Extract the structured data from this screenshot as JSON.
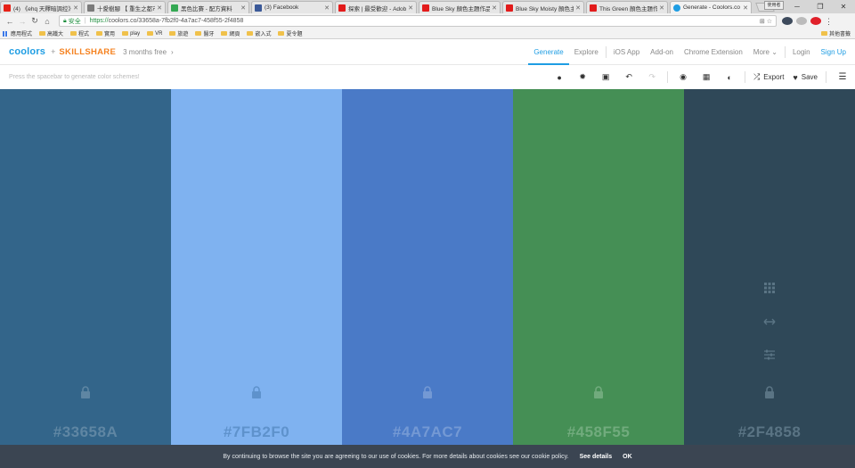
{
  "browser": {
    "tabs": [
      {
        "title": "(4) 《ehq 天釋暗調控》",
        "icon_color": "#e62117",
        "active": false
      },
      {
        "title": "十愛樹腳 【 重生之都市",
        "icon_color": "#7a7a7a",
        "active": false
      },
      {
        "title": "黑色比賽 - 配方資料",
        "icon_color": "#34a853",
        "active": false
      },
      {
        "title": "(3) Facebook",
        "icon_color": "#3b5998",
        "active": false
      },
      {
        "title": "探索 | 最受歡迎 - Adob",
        "icon_color": "#e21b1b",
        "active": false
      },
      {
        "title": "Blue Sky 顏色主題作品",
        "icon_color": "#e21b1b",
        "active": false
      },
      {
        "title": "Blue Sky Moisty 顏色主",
        "icon_color": "#e21b1b",
        "active": false
      },
      {
        "title": "This Green 顏色主題作品",
        "icon_color": "#e21b1b",
        "active": false
      },
      {
        "title": "Generate - Coolors.co",
        "icon_color": "#1e9de3",
        "active": true
      }
    ],
    "user_box": "使用者",
    "secure_label": "安全",
    "url_protocol": "https://",
    "url_rest": "coolors.co/33658a-7fb2f0-4a7ac7-458f55-2f4858",
    "bookmarks": [
      "應用程式",
      "高鐵大",
      "程式",
      "實用",
      "play",
      "VR",
      "旅遊",
      "醫牙",
      "網頁",
      "嵌入式",
      "夏令題"
    ],
    "bookmarks_right": "其他書籤"
  },
  "header": {
    "logo": "coolors",
    "plus": "+",
    "partner": "SKILLSHARE",
    "promo": "3 months free",
    "nav": [
      "Generate",
      "Explore",
      "iOS App",
      "Add-on",
      "Chrome Extension",
      "More"
    ],
    "login": "Login",
    "signup": "Sign Up"
  },
  "toolbar": {
    "hint": "Press the spacebar to generate color schemes!",
    "export_label": "Export",
    "save_label": "Save"
  },
  "palette": [
    {
      "hex": "#33658A",
      "color": "#33658a",
      "text_color": "#5f86a3"
    },
    {
      "hex": "#7FB2F0",
      "color": "#7fb2f0",
      "text_color": "#5e92cc"
    },
    {
      "hex": "#4A7AC7",
      "color": "#4a7ac7",
      "text_color": "#7499d4"
    },
    {
      "hex": "#458F55",
      "color": "#458f55",
      "text_color": "#71ab7d"
    },
    {
      "hex": "#2F4858",
      "color": "#2f4858",
      "text_color": "#5a7484"
    }
  ],
  "cookie": {
    "message": "By continuing to browse the site you are agreeing to our use of cookies. For more details about cookies see our cookie policy.",
    "details": "See details",
    "ok": "OK"
  }
}
